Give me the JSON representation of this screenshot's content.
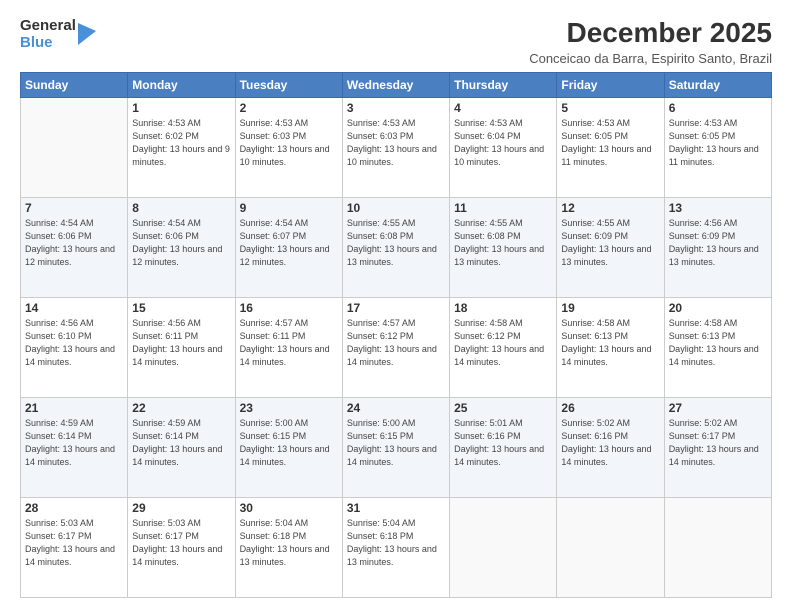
{
  "logo": {
    "general": "General",
    "blue": "Blue"
  },
  "header": {
    "month": "December 2025",
    "location": "Conceicao da Barra, Espirito Santo, Brazil"
  },
  "days_of_week": [
    "Sunday",
    "Monday",
    "Tuesday",
    "Wednesday",
    "Thursday",
    "Friday",
    "Saturday"
  ],
  "weeks": [
    [
      {
        "day": "",
        "sunrise": "",
        "sunset": "",
        "daylight": ""
      },
      {
        "day": "1",
        "sunrise": "Sunrise: 4:53 AM",
        "sunset": "Sunset: 6:02 PM",
        "daylight": "Daylight: 13 hours and 9 minutes."
      },
      {
        "day": "2",
        "sunrise": "Sunrise: 4:53 AM",
        "sunset": "Sunset: 6:03 PM",
        "daylight": "Daylight: 13 hours and 10 minutes."
      },
      {
        "day": "3",
        "sunrise": "Sunrise: 4:53 AM",
        "sunset": "Sunset: 6:03 PM",
        "daylight": "Daylight: 13 hours and 10 minutes."
      },
      {
        "day": "4",
        "sunrise": "Sunrise: 4:53 AM",
        "sunset": "Sunset: 6:04 PM",
        "daylight": "Daylight: 13 hours and 10 minutes."
      },
      {
        "day": "5",
        "sunrise": "Sunrise: 4:53 AM",
        "sunset": "Sunset: 6:05 PM",
        "daylight": "Daylight: 13 hours and 11 minutes."
      },
      {
        "day": "6",
        "sunrise": "Sunrise: 4:53 AM",
        "sunset": "Sunset: 6:05 PM",
        "daylight": "Daylight: 13 hours and 11 minutes."
      }
    ],
    [
      {
        "day": "7",
        "sunrise": "Sunrise: 4:54 AM",
        "sunset": "Sunset: 6:06 PM",
        "daylight": "Daylight: 13 hours and 12 minutes."
      },
      {
        "day": "8",
        "sunrise": "Sunrise: 4:54 AM",
        "sunset": "Sunset: 6:06 PM",
        "daylight": "Daylight: 13 hours and 12 minutes."
      },
      {
        "day": "9",
        "sunrise": "Sunrise: 4:54 AM",
        "sunset": "Sunset: 6:07 PM",
        "daylight": "Daylight: 13 hours and 12 minutes."
      },
      {
        "day": "10",
        "sunrise": "Sunrise: 4:55 AM",
        "sunset": "Sunset: 6:08 PM",
        "daylight": "Daylight: 13 hours and 13 minutes."
      },
      {
        "day": "11",
        "sunrise": "Sunrise: 4:55 AM",
        "sunset": "Sunset: 6:08 PM",
        "daylight": "Daylight: 13 hours and 13 minutes."
      },
      {
        "day": "12",
        "sunrise": "Sunrise: 4:55 AM",
        "sunset": "Sunset: 6:09 PM",
        "daylight": "Daylight: 13 hours and 13 minutes."
      },
      {
        "day": "13",
        "sunrise": "Sunrise: 4:56 AM",
        "sunset": "Sunset: 6:09 PM",
        "daylight": "Daylight: 13 hours and 13 minutes."
      }
    ],
    [
      {
        "day": "14",
        "sunrise": "Sunrise: 4:56 AM",
        "sunset": "Sunset: 6:10 PM",
        "daylight": "Daylight: 13 hours and 14 minutes."
      },
      {
        "day": "15",
        "sunrise": "Sunrise: 4:56 AM",
        "sunset": "Sunset: 6:11 PM",
        "daylight": "Daylight: 13 hours and 14 minutes."
      },
      {
        "day": "16",
        "sunrise": "Sunrise: 4:57 AM",
        "sunset": "Sunset: 6:11 PM",
        "daylight": "Daylight: 13 hours and 14 minutes."
      },
      {
        "day": "17",
        "sunrise": "Sunrise: 4:57 AM",
        "sunset": "Sunset: 6:12 PM",
        "daylight": "Daylight: 13 hours and 14 minutes."
      },
      {
        "day": "18",
        "sunrise": "Sunrise: 4:58 AM",
        "sunset": "Sunset: 6:12 PM",
        "daylight": "Daylight: 13 hours and 14 minutes."
      },
      {
        "day": "19",
        "sunrise": "Sunrise: 4:58 AM",
        "sunset": "Sunset: 6:13 PM",
        "daylight": "Daylight: 13 hours and 14 minutes."
      },
      {
        "day": "20",
        "sunrise": "Sunrise: 4:58 AM",
        "sunset": "Sunset: 6:13 PM",
        "daylight": "Daylight: 13 hours and 14 minutes."
      }
    ],
    [
      {
        "day": "21",
        "sunrise": "Sunrise: 4:59 AM",
        "sunset": "Sunset: 6:14 PM",
        "daylight": "Daylight: 13 hours and 14 minutes."
      },
      {
        "day": "22",
        "sunrise": "Sunrise: 4:59 AM",
        "sunset": "Sunset: 6:14 PM",
        "daylight": "Daylight: 13 hours and 14 minutes."
      },
      {
        "day": "23",
        "sunrise": "Sunrise: 5:00 AM",
        "sunset": "Sunset: 6:15 PM",
        "daylight": "Daylight: 13 hours and 14 minutes."
      },
      {
        "day": "24",
        "sunrise": "Sunrise: 5:00 AM",
        "sunset": "Sunset: 6:15 PM",
        "daylight": "Daylight: 13 hours and 14 minutes."
      },
      {
        "day": "25",
        "sunrise": "Sunrise: 5:01 AM",
        "sunset": "Sunset: 6:16 PM",
        "daylight": "Daylight: 13 hours and 14 minutes."
      },
      {
        "day": "26",
        "sunrise": "Sunrise: 5:02 AM",
        "sunset": "Sunset: 6:16 PM",
        "daylight": "Daylight: 13 hours and 14 minutes."
      },
      {
        "day": "27",
        "sunrise": "Sunrise: 5:02 AM",
        "sunset": "Sunset: 6:17 PM",
        "daylight": "Daylight: 13 hours and 14 minutes."
      }
    ],
    [
      {
        "day": "28",
        "sunrise": "Sunrise: 5:03 AM",
        "sunset": "Sunset: 6:17 PM",
        "daylight": "Daylight: 13 hours and 14 minutes."
      },
      {
        "day": "29",
        "sunrise": "Sunrise: 5:03 AM",
        "sunset": "Sunset: 6:17 PM",
        "daylight": "Daylight: 13 hours and 14 minutes."
      },
      {
        "day": "30",
        "sunrise": "Sunrise: 5:04 AM",
        "sunset": "Sunset: 6:18 PM",
        "daylight": "Daylight: 13 hours and 13 minutes."
      },
      {
        "day": "31",
        "sunrise": "Sunrise: 5:04 AM",
        "sunset": "Sunset: 6:18 PM",
        "daylight": "Daylight: 13 hours and 13 minutes."
      },
      {
        "day": "",
        "sunrise": "",
        "sunset": "",
        "daylight": ""
      },
      {
        "day": "",
        "sunrise": "",
        "sunset": "",
        "daylight": ""
      },
      {
        "day": "",
        "sunrise": "",
        "sunset": "",
        "daylight": ""
      }
    ]
  ]
}
